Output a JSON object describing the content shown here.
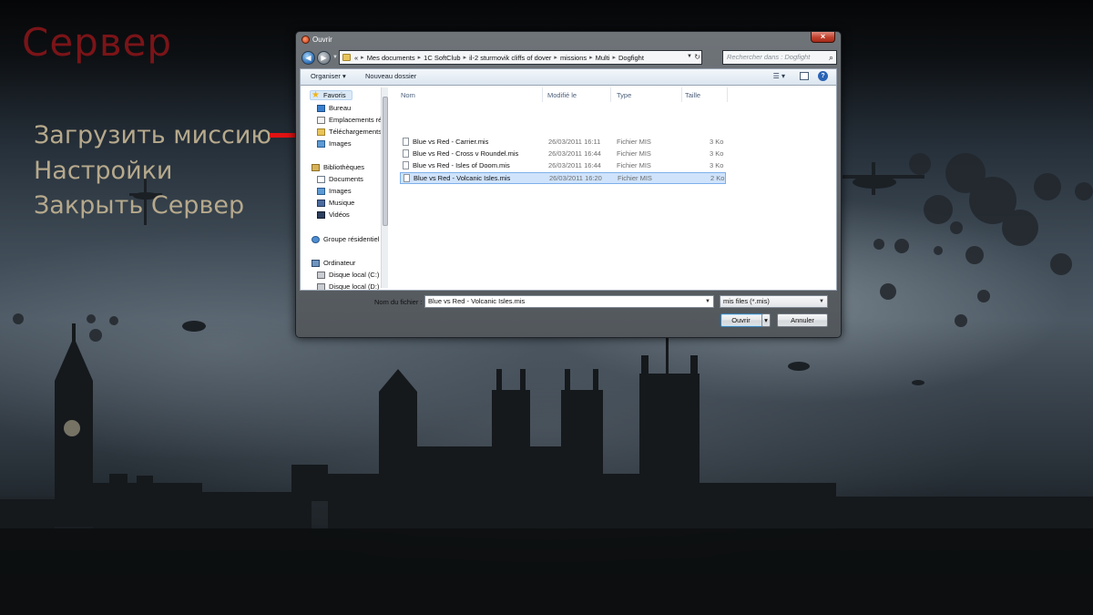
{
  "game": {
    "title": "Сервер",
    "menu": [
      "Загрузить миссию",
      "Настройки",
      "Закрыть Сервер"
    ],
    "accent_color": "#7a1418",
    "marker_color": "#e11212"
  },
  "dialog": {
    "title": "Ouvrir",
    "close_icon": "×",
    "breadcrumb_prefix": "«",
    "breadcrumb": [
      "Mes documents",
      "1C SoftClub",
      "il-2 sturmovik cliffs of dover",
      "missions",
      "Multi",
      "Dogfight"
    ],
    "search_placeholder": "Rechercher dans : Dogfight",
    "toolbar": {
      "organize": "Organiser ▾",
      "new_folder": "Nouveau dossier"
    },
    "nav": {
      "favorites": "Favoris",
      "favorites_items": [
        "Bureau",
        "Emplacements ré",
        "Téléchargements",
        "Images"
      ],
      "libraries": "Bibliothèques",
      "libraries_items": [
        "Documents",
        "Images",
        "Musique",
        "Vidéos"
      ],
      "homegroup": "Groupe résidentiel",
      "computer": "Ordinateur",
      "computer_items": [
        "Disque local (C:)",
        "Disque local (D:)"
      ]
    },
    "columns": {
      "name": "Nom",
      "modified": "Modifié le",
      "type": "Type",
      "size": "Taille"
    },
    "files": [
      {
        "name": "Blue vs Red - Carrier.mis",
        "modified": "26/03/2011 16:11",
        "type": "Fichier MIS",
        "size": "3 Ko"
      },
      {
        "name": "Blue vs Red - Cross v Roundel.mis",
        "modified": "26/03/2011 16:44",
        "type": "Fichier MIS",
        "size": "3 Ko"
      },
      {
        "name": "Blue vs Red - Isles of Doom.mis",
        "modified": "26/03/2011 16:44",
        "type": "Fichier MIS",
        "size": "3 Ko"
      },
      {
        "name": "Blue vs Red - Volcanic Isles.mis",
        "modified": "26/03/2011 16:20",
        "type": "Fichier MIS",
        "size": "2 Ko"
      }
    ],
    "selected_index": 3,
    "filename_label": "Nom du fichier :",
    "filename_value": "Blue vs Red - Volcanic Isles.mis",
    "filetype_value": "mis files (*.mis)",
    "open_button": "Ouvrir",
    "cancel_button": "Annuler"
  }
}
